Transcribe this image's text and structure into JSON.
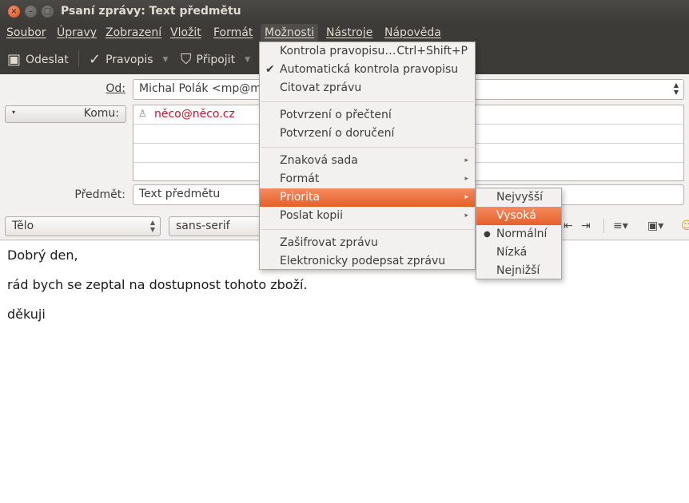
{
  "window": {
    "title": "Psaní zprávy: Text předmětu"
  },
  "menubar": {
    "items": [
      "Soubor",
      "Úpravy",
      "Zobrazení",
      "Vložit",
      "Formát",
      "Možnosti",
      "Nástroje",
      "Nápověda"
    ]
  },
  "toolbar": {
    "send": "Odeslat",
    "spell": "Pravopis",
    "attach": "Připojit"
  },
  "header": {
    "from_label": "Od:",
    "from_value": "Michal Polák <mp@mi",
    "to_button": "Komu:",
    "to_value": "něco@něco.cz",
    "subject_label": "Předmět:",
    "subject_value": "Text předmětu"
  },
  "format": {
    "paragraph": "Tělo",
    "font": "sans-serif"
  },
  "body": {
    "lines": [
      "Dobrý den,",
      "rád bych se zeptal na dostupnost tohoto zboží.",
      "děkuji"
    ]
  },
  "options_menu": {
    "items": [
      {
        "label": "Kontrola pravopisu…",
        "accel": "Ctrl+Shift+P"
      },
      {
        "label": "Automatická kontrola pravopisu",
        "checked": true
      },
      {
        "label": "Citovat zprávu"
      },
      {
        "label": "Potvrzení o přečtení"
      },
      {
        "label": "Potvrzení o doručení"
      },
      {
        "label": "Znaková sada",
        "submenu": true
      },
      {
        "label": "Formát",
        "submenu": true
      },
      {
        "label": "Priorita",
        "submenu": true,
        "highlighted": true
      },
      {
        "label": "Poslat kopii",
        "submenu": true
      },
      {
        "label": "Zašifrovat zprávu"
      },
      {
        "label": "Elektronicky podepsat zprávu"
      }
    ]
  },
  "priority_menu": {
    "items": [
      {
        "label": "Nejvyšší"
      },
      {
        "label": "Vysoká",
        "highlighted": true
      },
      {
        "label": "Normální",
        "selected": true
      },
      {
        "label": "Nízká"
      },
      {
        "label": "Nejnižší"
      }
    ]
  },
  "colors": {
    "accent": "#e6602a",
    "recipient": "#c7162b",
    "titlebar": "#3c3b37"
  }
}
